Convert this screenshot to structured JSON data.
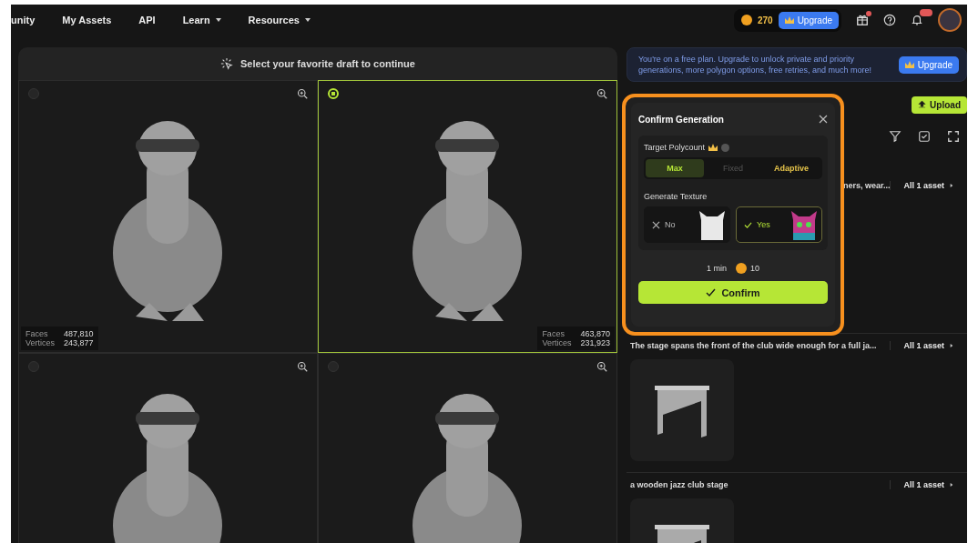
{
  "nav": {
    "items": [
      {
        "label": "unity",
        "dropdown": false
      },
      {
        "label": "My Assets",
        "dropdown": false
      },
      {
        "label": "API",
        "dropdown": false
      },
      {
        "label": "Learn",
        "dropdown": true
      },
      {
        "label": "Resources",
        "dropdown": true
      }
    ],
    "credits": "270",
    "upgrade": "Upgrade",
    "gift_dot": true,
    "notification_badge": true
  },
  "drafts_panel": {
    "title": "Select your favorite draft to continue",
    "drafts": [
      {
        "selected": false,
        "stats": [
          {
            "label": "Faces",
            "value": "487,810"
          },
          {
            "label": "Vertices",
            "value": "243,877"
          }
        ]
      },
      {
        "selected": true,
        "stats": [
          {
            "label": "Faces",
            "value": "463,870"
          },
          {
            "label": "Vertices",
            "value": "231,923"
          }
        ]
      },
      {
        "selected": false
      },
      {
        "selected": false
      }
    ]
  },
  "banner": {
    "text": "You're on a free plan. Upgrade to unlock private and priority generations, more polygon options, free retries, and much more!",
    "button": "Upgrade"
  },
  "upload": "Upload",
  "prompts": [
    {
      "text": "ners, wear...",
      "link": "All 1 asset",
      "thumbnail": false
    },
    {
      "text": "The stage spans the front of the club wide enough for a full ja...",
      "link": "All 1 asset",
      "thumbnail": true
    },
    {
      "text": "a wooden jazz club stage",
      "link": "All 1 asset",
      "thumbnail": true
    }
  ],
  "dialog": {
    "title": "Confirm Generation",
    "polycount_label": "Target Polycount",
    "polycount_options": [
      {
        "label": "Max",
        "selected": true,
        "disabled": false,
        "premium": false
      },
      {
        "label": "Fixed",
        "selected": false,
        "disabled": true,
        "premium": false
      },
      {
        "label": "Adaptive",
        "selected": false,
        "disabled": false,
        "premium": true
      }
    ],
    "texture_label": "Generate Texture",
    "texture_options": [
      {
        "label": "No",
        "kind": "no",
        "selected": false
      },
      {
        "label": "Yes",
        "kind": "yes",
        "selected": true
      }
    ],
    "time": "1 min",
    "cost": "10",
    "confirm": "Confirm"
  }
}
